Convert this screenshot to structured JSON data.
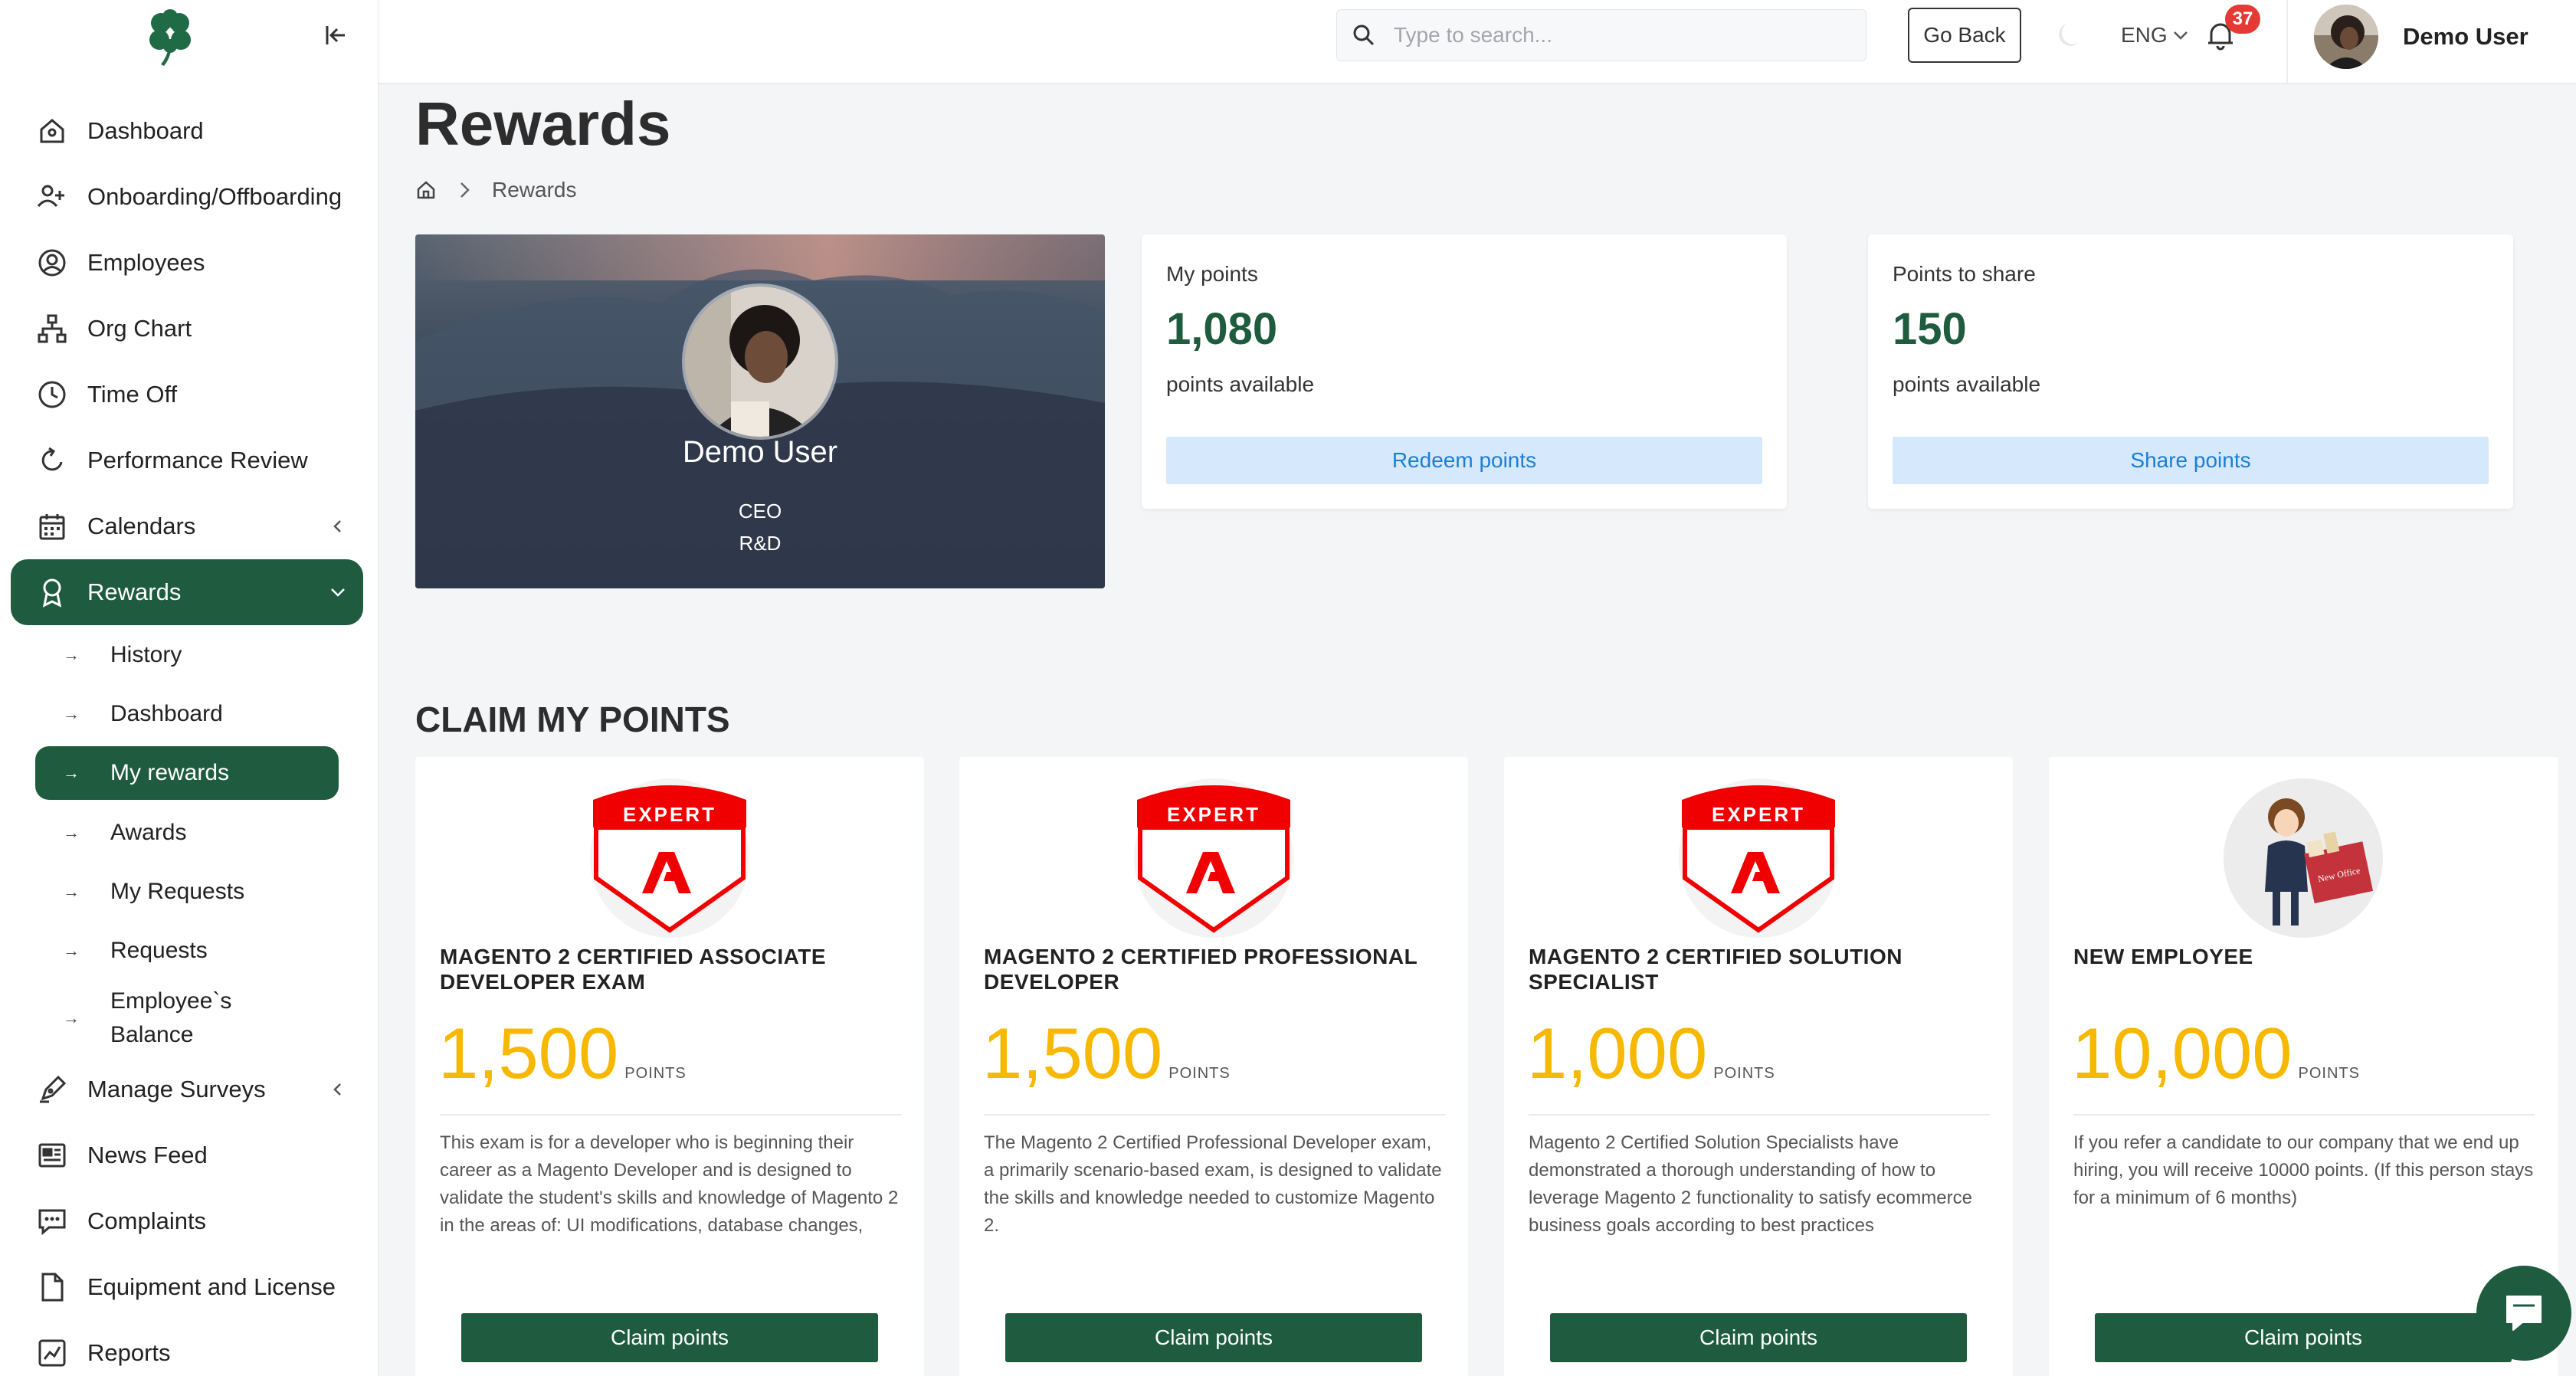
{
  "sidebar": {
    "items": [
      {
        "label": "Dashboard",
        "icon": "home-icon"
      },
      {
        "label": "Onboarding/Offboarding",
        "icon": "user-plus-icon"
      },
      {
        "label": "Employees",
        "icon": "user-circle-icon"
      },
      {
        "label": "Org Chart",
        "icon": "org-chart-icon"
      },
      {
        "label": "Time Off",
        "icon": "clock-icon"
      },
      {
        "label": "Performance Review",
        "icon": "refresh-icon"
      },
      {
        "label": "Calendars",
        "icon": "calendar-icon"
      },
      {
        "label": "Rewards",
        "icon": "award-icon"
      },
      {
        "label": "Manage Surveys",
        "icon": "pen-icon"
      },
      {
        "label": "News Feed",
        "icon": "newspaper-icon"
      },
      {
        "label": "Complaints",
        "icon": "chat-icon"
      },
      {
        "label": "Equipment and License",
        "icon": "file-icon"
      },
      {
        "label": "Reports",
        "icon": "chart-icon"
      }
    ],
    "rewards_sub": [
      {
        "label": "History"
      },
      {
        "label": "Dashboard"
      },
      {
        "label": "My rewards"
      },
      {
        "label": "Awards"
      },
      {
        "label": "My Requests"
      },
      {
        "label": "Requests"
      },
      {
        "label": "Employee`s Balance"
      }
    ]
  },
  "header": {
    "search_placeholder": "Type to search...",
    "go_back": "Go Back",
    "language": "ENG",
    "notifications": "37",
    "user_name": "Demo User"
  },
  "page": {
    "title": "Rewards",
    "breadcrumb": "Rewards"
  },
  "profile": {
    "name": "Demo User",
    "role": "CEO",
    "department": "R&D"
  },
  "my_points": {
    "label": "My points",
    "value": "1,080",
    "sub": "points available",
    "button": "Redeem points"
  },
  "share_points": {
    "label": "Points to share",
    "value": "150",
    "sub": "points available",
    "button": "Share points"
  },
  "claim": {
    "title": "CLAIM MY POINTS",
    "badge_text": "EXPERT",
    "unit": "POINTS",
    "button": "Claim points",
    "cards": [
      {
        "title": "MAGENTO 2 CERTIFIED ASSOCIATE DEVELOPER EXAM",
        "points": "1,500",
        "desc": "This exam is for a developer who is beginning their career as a Magento Developer and is designed to validate the student's skills and knowledge of Magento 2 in the areas of: UI modifications, database changes, admin modifications"
      },
      {
        "title": "MAGENTO 2 CERTIFIED PROFESSIONAL DEVELOPER",
        "points": "1,500",
        "desc": "The Magento 2 Certified Professional Developer exam, a primarily scenario-based exam, is designed to validate the skills and knowledge needed to customize Magento 2."
      },
      {
        "title": "MAGENTO 2 CERTIFIED SOLUTION SPECIALIST",
        "points": "1,000",
        "desc": "Magento 2 Certified Solution Specialists have demonstrated a thorough understanding of how to leverage Magento 2 functionality to satisfy ecommerce business goals according to best practices"
      },
      {
        "title": "NEW EMPLOYEE",
        "points": "10,000",
        "desc": "If you refer a candidate to our company that we end up hiring, you will receive 10000 points. (If this person stays for a minimum of 6 months)",
        "illustration_text": "New Office"
      }
    ]
  },
  "colors": {
    "brand": "#1f5c3f",
    "points_gold": "#f6b800",
    "badge_red": "#e53935",
    "link_blue": "#1c7ed6"
  }
}
